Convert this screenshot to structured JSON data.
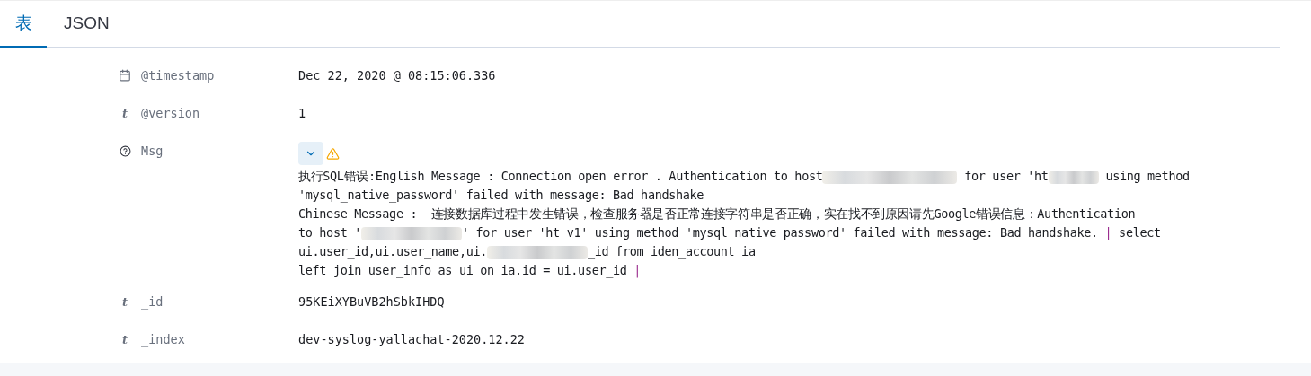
{
  "tabs": [
    {
      "label": "表",
      "selected": true
    },
    {
      "label": "JSON",
      "selected": false
    }
  ],
  "fields": [
    {
      "kind": "date",
      "name": "@timestamp",
      "value": "Dec 22, 2020 @ 08:15:06.336"
    },
    {
      "kind": "string",
      "glyph": "t",
      "name": "@version",
      "value": "1"
    },
    {
      "kind": "unknown",
      "name": "Msg",
      "expanded": true,
      "warning": true,
      "lines": [
        [
          {
            "kind": "text",
            "text": "执行SQL错误:English Message : Connection open error . Authentication to host"
          },
          {
            "kind": "redacted"
          },
          {
            "kind": "text",
            "text": " for user 'ht"
          },
          {
            "kind": "redacted"
          },
          {
            "kind": "text",
            "text": " using method"
          }
        ],
        [
          {
            "kind": "text",
            "text": "'mysql_native_password' failed with message: Bad handshake"
          }
        ],
        [
          {
            "kind": "text",
            "text": "Chinese Message :  连接数据库过程中发生错误，检查服务器是否正常连接字符串是否正确，实在找不到原因请先Google错误信息：Authentication"
          }
        ],
        [
          {
            "kind": "text",
            "text": "to host '"
          },
          {
            "kind": "redacted"
          },
          {
            "kind": "text",
            "text": "' for user 'ht_v1' using method 'mysql_native_password' failed with message: Bad handshake. "
          },
          {
            "kind": "separator",
            "text": "|"
          },
          {
            "kind": "text",
            "text": " select"
          }
        ],
        [
          {
            "kind": "text",
            "text": "ui.user_id,ui.user_name,ui."
          },
          {
            "kind": "redacted"
          },
          {
            "kind": "text",
            "text": "_id from iden_account ia"
          }
        ],
        [
          {
            "kind": "text",
            "text": "left join user_info as ui on ia.id = ui.user_id "
          },
          {
            "kind": "separator",
            "text": "|"
          }
        ]
      ]
    },
    {
      "kind": "string",
      "glyph": "t",
      "name": "_id",
      "value": "95KEiXYBuVB2hSbkIHDQ"
    },
    {
      "kind": "string",
      "glyph": "t",
      "name": "_index",
      "value": "dev-syslog-yallachat-2020.12.22"
    }
  ]
}
